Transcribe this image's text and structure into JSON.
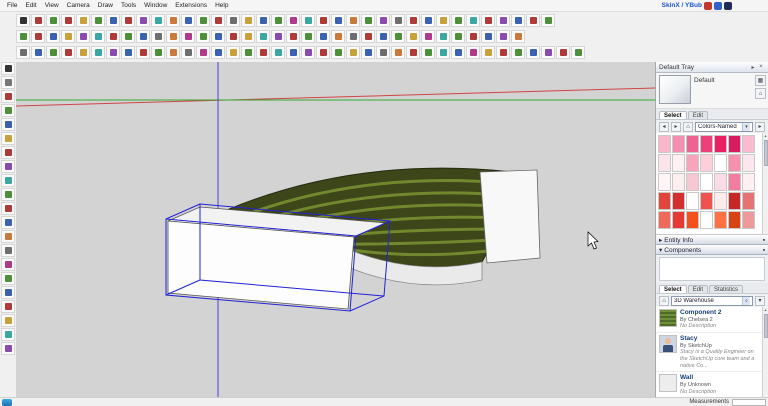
{
  "menu": {
    "items": [
      "File",
      "Edit",
      "View",
      "Camera",
      "Draw",
      "Tools",
      "Window",
      "Extensions",
      "Help"
    ],
    "plugin_title": "SkinX / YBub",
    "plugin_icon_colors": [
      "#c0392b",
      "#2e62c9",
      "#222a5a"
    ]
  },
  "icons": {
    "close": "×",
    "arrow_right": "▸",
    "arrow_left": "◂",
    "arrow_down": "▾",
    "arrow_up": "▴",
    "house": "⌂",
    "search": "⌕",
    "palette": "▦",
    "pin": "▪"
  },
  "toolbars": {
    "row1": {
      "icons": [
        "#333333",
        "#b03a37",
        "#4e8f3a",
        "#b03a37",
        "#c9a13b",
        "#4e8f3a",
        "#3a62b0",
        "#b03a37",
        "#8a4ab0",
        "#3aa8a0",
        "#c97a3b",
        "#3a62b0",
        "#4e8f3a",
        "#b03a37",
        "#6e6e6e",
        "#c9a13b",
        "#3a62b0",
        "#4e8f3a",
        "#b03a8a",
        "#3aa8a0",
        "#b03a37",
        "#3a62b0",
        "#c97a3b",
        "#4e8f3a",
        "#8a4ab0",
        "#6e6e6e",
        "#b03a37",
        "#3a62b0",
        "#c9a13b",
        "#4e8f3a",
        "#3aa8a0",
        "#b03a37",
        "#8a4ab0",
        "#3a62b0",
        "#b03a37",
        "#4e8f3a"
      ]
    },
    "row2": {
      "icons": [
        "#4e8f3a",
        "#b03a37",
        "#3a62b0",
        "#c9a13b",
        "#8a4ab0",
        "#3aa8a0",
        "#b03a37",
        "#4e8f3a",
        "#3a62b0",
        "#6e6e6e",
        "#c97a3b",
        "#b03a8a",
        "#4e8f3a",
        "#3a62b0",
        "#b03a37",
        "#c9a13b",
        "#3aa8a0",
        "#8a4ab0",
        "#b03a37",
        "#4e8f3a",
        "#3a62b0",
        "#c97a3b",
        "#6e6e6e",
        "#b03a37",
        "#3a62b0",
        "#4e8f3a",
        "#c9a13b",
        "#b03a8a",
        "#3aa8a0",
        "#4e8f3a",
        "#b03a37",
        "#3a62b0",
        "#8a4ab0",
        "#c97a3b"
      ]
    },
    "row3": {
      "icons": [
        "#6e6e6e",
        "#3a62b0",
        "#4e8f3a",
        "#b03a37",
        "#c9a13b",
        "#3aa8a0",
        "#8a4ab0",
        "#3a62b0",
        "#b03a37",
        "#4e8f3a",
        "#c97a3b",
        "#6e6e6e",
        "#b03a8a",
        "#3a62b0",
        "#c9a13b",
        "#4e8f3a",
        "#b03a37",
        "#3aa8a0",
        "#3a62b0",
        "#8a4ab0",
        "#b03a37",
        "#4e8f3a",
        "#c9a13b",
        "#3a62b0",
        "#6e6e6e",
        "#c97a3b",
        "#b03a37",
        "#4e8f3a",
        "#3aa8a0",
        "#3a62b0",
        "#b03a8a",
        "#c9a13b",
        "#b03a37",
        "#4e8f3a",
        "#3a62b0",
        "#8a4ab0",
        "#b03a37",
        "#4e8f3a"
      ]
    },
    "left": {
      "icons": [
        "#333333",
        "#777777",
        "#b03a37",
        "#4e8f3a",
        "#3a62b0",
        "#c9a13b",
        "#b03a37",
        "#8a4ab0",
        "#3aa8a0",
        "#4e8f3a",
        "#b03a37",
        "#3a62b0",
        "#c97a3b",
        "#6e6e6e",
        "#b03a8a",
        "#4e8f3a",
        "#3a62b0",
        "#b03a37",
        "#c9a13b",
        "#3aa8a0",
        "#8a4ab0"
      ]
    }
  },
  "tray": {
    "title": "Default Tray",
    "materials": {
      "preview_label": "Default",
      "tabs": [
        "Select",
        "Edit"
      ],
      "dropdown": "Colors-Named",
      "swatches": [
        "#f9b7c9",
        "#f48fb1",
        "#f06292",
        "#ec407a",
        "#e91e63",
        "#d81b60",
        "#f8bbd0",
        "#fde3ea",
        "#fff1f3",
        "#f8a5bb",
        "#fccfdb",
        "#ffffff",
        "#f591ad",
        "#fde6ee",
        "#fff5f6",
        "#fdeef0",
        "#f7c8d4",
        "#ffffff",
        "#fbdce6",
        "#f17ea0",
        "#fff0f3",
        "#e2453c",
        "#d32f2f",
        "#ffffff",
        "#ef5350",
        "#fdecea",
        "#c62828",
        "#e57373",
        "#ef6a5a",
        "#e53935",
        "#f4511e",
        "#ffffff",
        "#ff7043",
        "#d84315",
        "#ef9a9a"
      ]
    },
    "sections": {
      "entity_info": "Entity Info",
      "components": "Components"
    },
    "components": {
      "tabs": [
        "Select",
        "Edit",
        "Statistics"
      ],
      "search_placeholder": "3D Warehouse",
      "items": [
        {
          "name": "Component 2",
          "by": "By Chelsea 2",
          "desc": "No Description",
          "thumb": "grass"
        },
        {
          "name": "Stacy",
          "by": "By SketchUp",
          "desc": "Stacy is a Quality Engineer on the SketchUp core team and a native Co...",
          "thumb": "person"
        },
        {
          "name": "Wall",
          "by": "By Unknown",
          "desc": "No Description",
          "thumb": "#ededed"
        }
      ]
    }
  },
  "statusbar": {
    "measurements_label": "Measurements"
  }
}
